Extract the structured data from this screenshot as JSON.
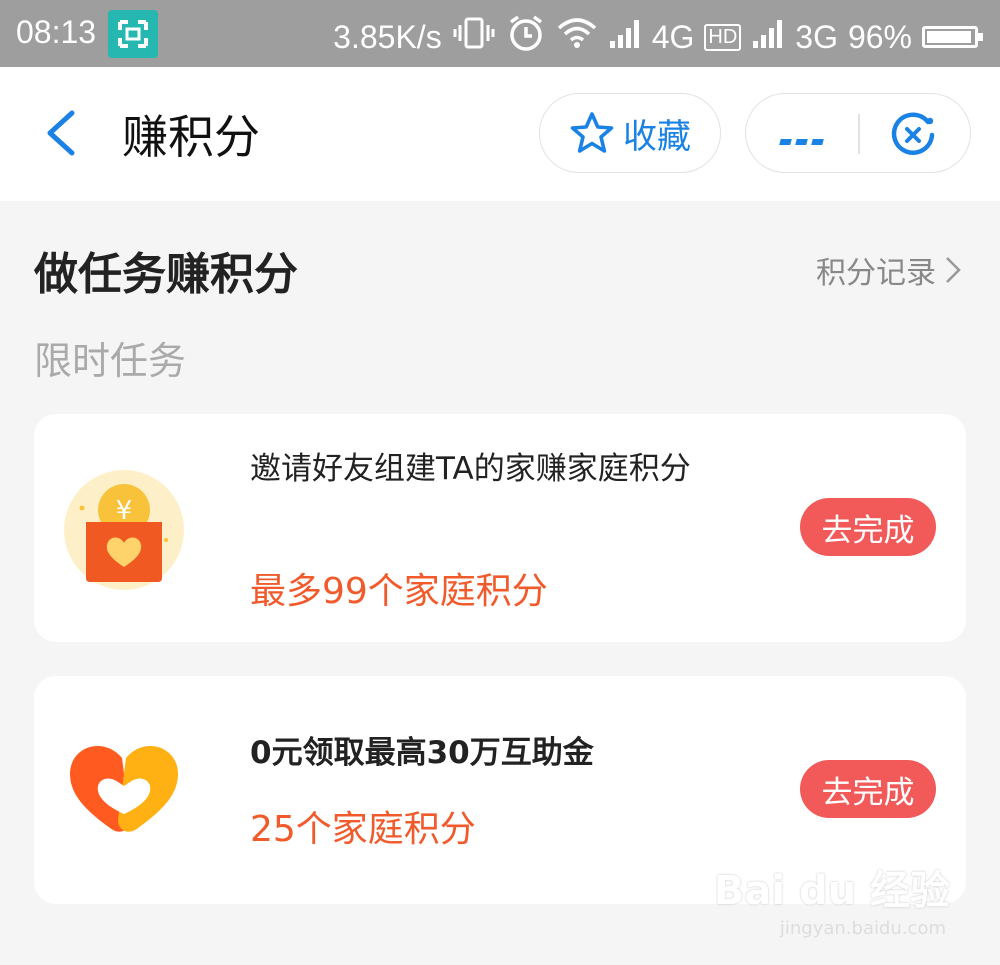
{
  "status_bar": {
    "time": "08:13",
    "speed": "3.85K/s",
    "net1": "4G",
    "net1_badge": "HD",
    "net2": "3G",
    "battery": "96%",
    "battery_level": 0.96
  },
  "header": {
    "title": "赚积分",
    "favorite_label": "收藏"
  },
  "section": {
    "title": "做任务赚积分",
    "records_link": "积分记录",
    "subheading": "限时任务"
  },
  "tasks": [
    {
      "title": "邀请好友组建TA的家赚家庭积分",
      "reward": "最多99个家庭积分",
      "action": "去完成",
      "icon": "red-envelope-heart-icon"
    },
    {
      "title": "0元领取最高30万互助金",
      "reward": "25个家庭积分",
      "action": "去完成",
      "icon": "orange-heart-logo-icon"
    }
  ],
  "watermark": {
    "logo": "Bai du 经验",
    "url": "jingyan.baidu.com"
  },
  "colors": {
    "accent": "#1a82e4",
    "reward": "#f15a2b",
    "button": "#f25a5a"
  }
}
